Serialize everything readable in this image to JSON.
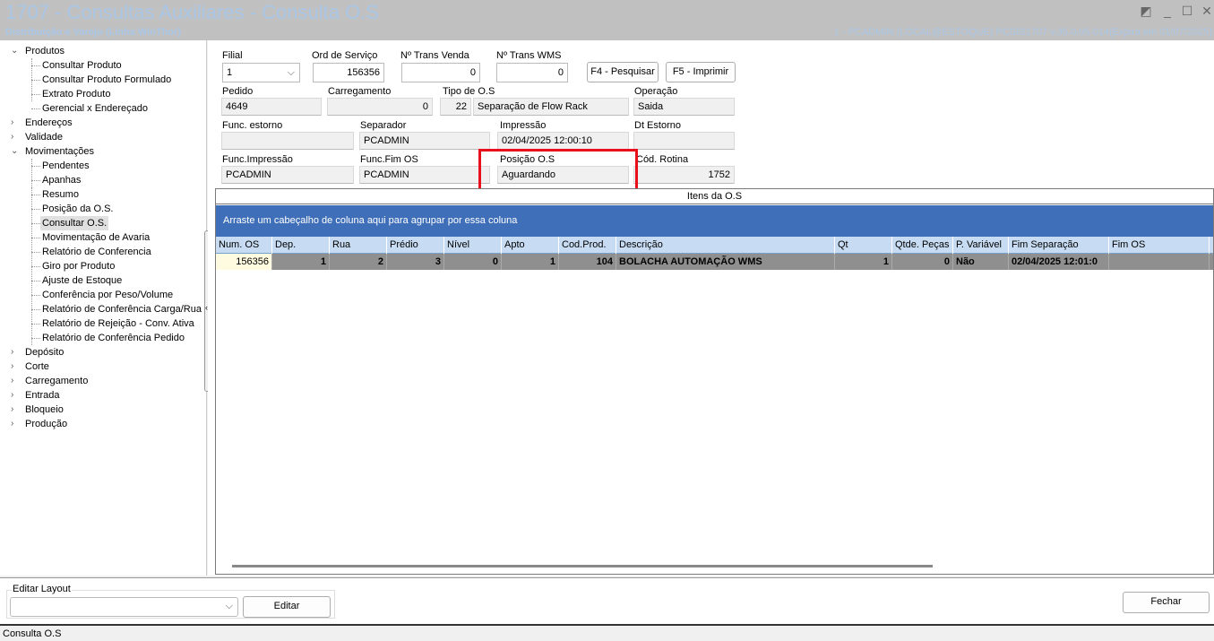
{
  "window": {
    "title": "1707 - Consultas Auxiliares - Consulta O.S",
    "subtitle": "Distribuição e Varejo (Linha WinThor)",
    "user_info": "1 - PCADMIN (LOCAL@ESTOQUE)   PCSIS1707  v.35.0.05.014(Expira em 01/07/2025)"
  },
  "tree": [
    {
      "label": "Produtos",
      "level": 0,
      "expanded": true
    },
    {
      "label": "Consultar Produto",
      "level": 1
    },
    {
      "label": "Consultar Produto Formulado",
      "level": 1
    },
    {
      "label": "Extrato Produto",
      "level": 1
    },
    {
      "label": "Gerencial x Endereçado",
      "level": 1
    },
    {
      "label": "Endereços",
      "level": 0,
      "expanded": false
    },
    {
      "label": "Validade",
      "level": 0,
      "expanded": false
    },
    {
      "label": "Movimentações",
      "level": 0,
      "expanded": true
    },
    {
      "label": "Pendentes",
      "level": 1
    },
    {
      "label": "Apanhas",
      "level": 1
    },
    {
      "label": "Resumo",
      "level": 1
    },
    {
      "label": "Posição da O.S.",
      "level": 1
    },
    {
      "label": "Consultar O.S.",
      "level": 1,
      "selected": true
    },
    {
      "label": "Movimentação de Avaria",
      "level": 1
    },
    {
      "label": "Relatório de Conferencia",
      "level": 1
    },
    {
      "label": "Giro por Produto",
      "level": 1
    },
    {
      "label": "Ajuste de Estoque",
      "level": 1
    },
    {
      "label": "Conferência por Peso/Volume",
      "level": 1
    },
    {
      "label": "Relatório de Conferência Carga/Rua",
      "level": 1
    },
    {
      "label": "Relatório de Rejeição - Conv. Ativa",
      "level": 1
    },
    {
      "label": "Relatório de Conferência Pedido",
      "level": 1
    },
    {
      "label": "Depósito",
      "level": 0,
      "expanded": false
    },
    {
      "label": "Corte",
      "level": 0,
      "expanded": false
    },
    {
      "label": "Carregamento",
      "level": 0,
      "expanded": false
    },
    {
      "label": "Entrada",
      "level": 0,
      "expanded": false
    },
    {
      "label": "Bloqueio",
      "level": 0,
      "expanded": false
    },
    {
      "label": "Produção",
      "level": 0,
      "expanded": false
    }
  ],
  "form": {
    "filial": {
      "label": "Filial",
      "value": "1"
    },
    "ord_servico": {
      "label": "Ord de Serviço",
      "value": "156356"
    },
    "trans_venda": {
      "label": "Nº Trans Venda",
      "value": "0"
    },
    "trans_wms": {
      "label": "Nº Trans WMS",
      "value": "0"
    },
    "pesquisar": "F4 - Pesquisar",
    "imprimir": "F5 - Imprimir",
    "pedido": {
      "label": "Pedido",
      "value": "4649"
    },
    "carregamento": {
      "label": "Carregamento",
      "value": "0"
    },
    "tipo_os": {
      "label": "Tipo de O.S",
      "code": "22",
      "value": "Separação de Flow Rack"
    },
    "operacao": {
      "label": "Operação",
      "value": "Saida"
    },
    "func_estorno": {
      "label": "Func. estorno",
      "value": ""
    },
    "separador": {
      "label": "Separador",
      "value": "PCADMIN"
    },
    "impressao": {
      "label": "Impressão",
      "value": "02/04/2025 12:00:10"
    },
    "dt_estorno": {
      "label": "Dt Estorno",
      "value": ""
    },
    "func_impressao": {
      "label": "Func.Impressão",
      "value": "PCADMIN"
    },
    "func_fim_os": {
      "label": "Func.Fim OS",
      "value": "PCADMIN"
    },
    "posicao_os": {
      "label": "Posição O.S",
      "value": "Aguardando"
    },
    "cod_rotina": {
      "label": "Cód. Rotina",
      "value": "1752"
    }
  },
  "grid": {
    "title": "Itens da O.S",
    "group_hint": "Arraste um cabeçalho de coluna aqui para agrupar por essa coluna",
    "columns": [
      "Num. OS",
      "Dep.",
      "Rua",
      "Prédio",
      "Nível",
      "Apto",
      "Cod.Prod.",
      "Descrição",
      "Qt",
      "Qtde. Peças",
      "P. Variável",
      "Fim Separação",
      "Fim OS"
    ],
    "rows": [
      [
        "156356",
        "1",
        "2",
        "3",
        "0",
        "1",
        "104",
        "BOLACHA AUTOMAÇÃO WMS",
        "1",
        "0",
        "Não",
        "02/04/2025 12:01:0",
        ""
      ]
    ]
  },
  "bottom": {
    "group_label": "Editar Layout",
    "layout_value": "",
    "editar": "Editar",
    "fechar": "Fechar"
  },
  "status": "Consulta O.S"
}
